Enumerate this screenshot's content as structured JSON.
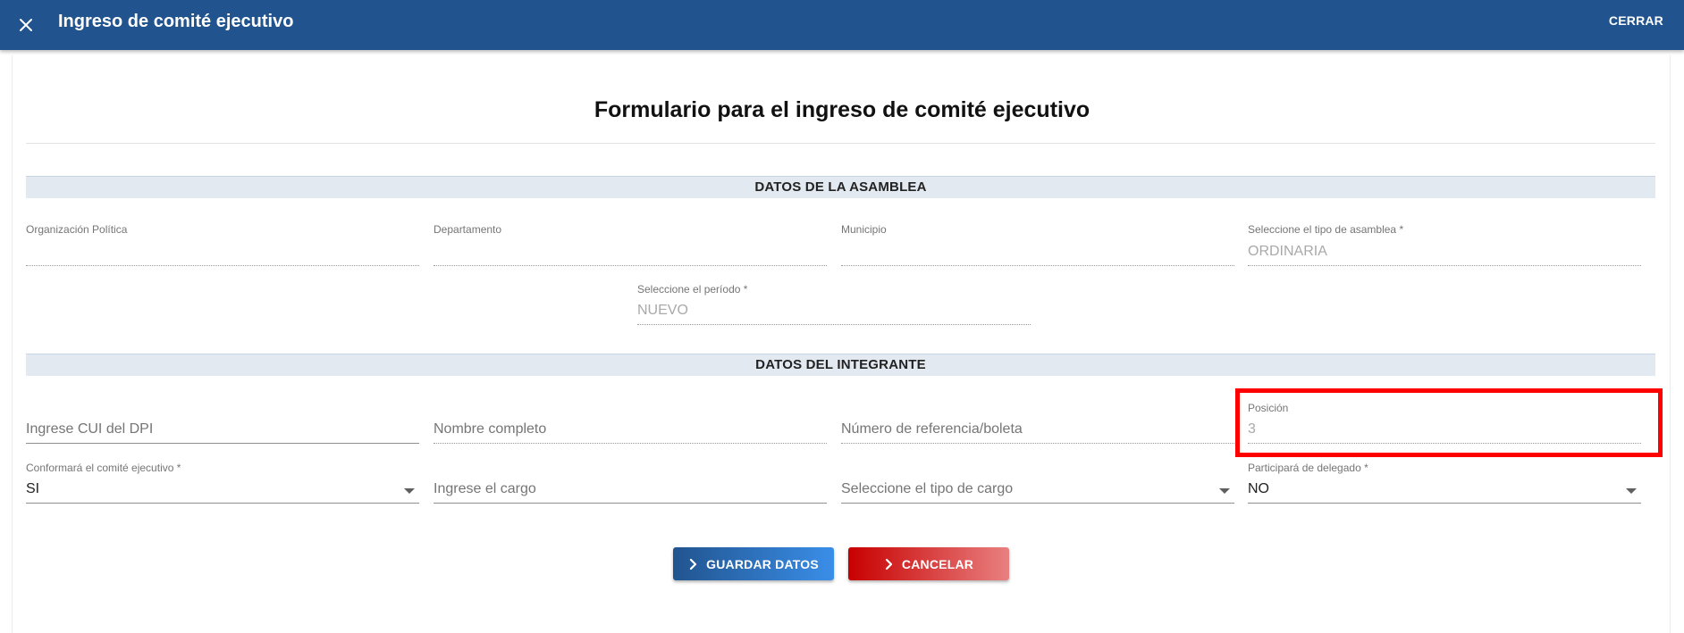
{
  "header": {
    "title": "Ingreso de comité ejecutivo",
    "close_icon": "close-icon",
    "close_label": "CERRAR"
  },
  "form": {
    "title": "Formulario para el ingreso de comité ejecutivo"
  },
  "asamblea": {
    "section_title": "DATOS DE LA ASAMBLEA",
    "organizacion_label": "Organización Política",
    "organizacion_value": "",
    "departamento_label": "Departamento",
    "departamento_value": "",
    "municipio_label": "Municipio",
    "municipio_value": "",
    "tipo_asamblea_label": "Seleccione el tipo de asamblea *",
    "tipo_asamblea_value": "ORDINARIA",
    "periodo_label": "Seleccione el período *",
    "periodo_value": "NUEVO"
  },
  "integrante": {
    "section_title": "DATOS DEL INTEGRANTE",
    "cui_placeholder": "Ingrese CUI del DPI",
    "nombre_placeholder": "Nombre completo",
    "referencia_placeholder": "Número de referencia/boleta",
    "posicion_label": "Posición",
    "posicion_value": "3",
    "conformara_label": "Conformará el comité ejecutivo *",
    "conformara_value": "SI",
    "cargo_placeholder": "Ingrese el cargo",
    "tipo_cargo_placeholder": "Seleccione el tipo de cargo",
    "delegado_label": "Participará de delegado *",
    "delegado_value": "NO"
  },
  "actions": {
    "save_label": "GUARDAR DATOS",
    "cancel_label": "CANCELAR",
    "chevron_icon": "chevron-right-icon"
  },
  "colors": {
    "header_bg": "#21548f",
    "section_bg": "#e2e9f0",
    "save_gradient": [
      "#21548f",
      "#3a8ee8"
    ],
    "cancel_gradient": [
      "#c80000",
      "#e98080"
    ],
    "highlight": "#ff0000"
  }
}
